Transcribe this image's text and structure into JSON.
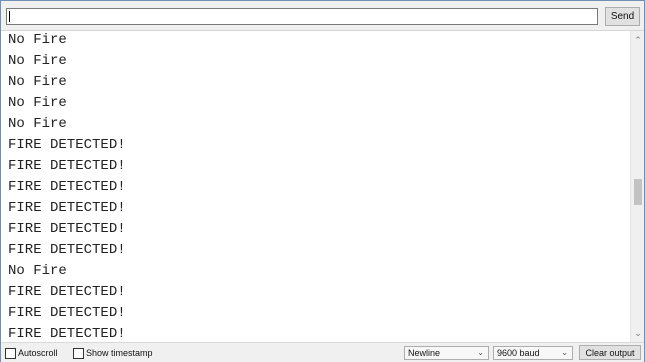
{
  "input": {
    "value": "",
    "placeholder": ""
  },
  "send_label": "Send",
  "output_lines": [
    "No Fire",
    "No Fire",
    "No Fire",
    "No Fire",
    "No Fire",
    "FIRE DETECTED!",
    "FIRE DETECTED!",
    "FIRE DETECTED!",
    "FIRE DETECTED!",
    "FIRE DETECTED!",
    "FIRE DETECTED!",
    "No Fire",
    "FIRE DETECTED!",
    "FIRE DETECTED!",
    "FIRE DETECTED!"
  ],
  "bottom": {
    "autoscroll_label": "Autoscroll",
    "autoscroll_checked": false,
    "timestamp_label": "Show timestamp",
    "timestamp_checked": false,
    "line_ending": "Newline",
    "baud_rate": "9600 baud",
    "clear_label": "Clear output"
  },
  "icons": {
    "scroll_up": "chevron-up-icon",
    "scroll_down": "chevron-down-icon",
    "dropdown": "chevron-down-icon"
  }
}
